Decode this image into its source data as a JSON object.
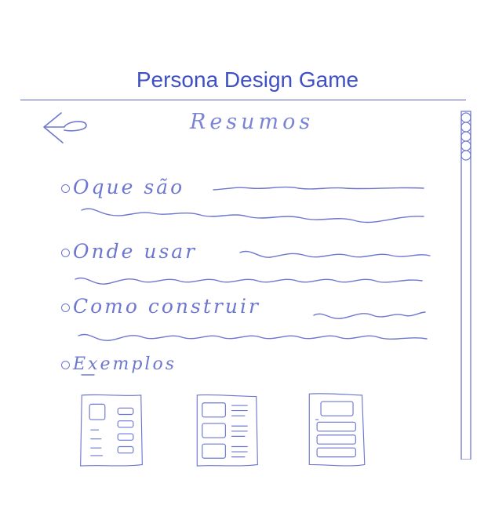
{
  "app": {
    "title": "Persona Design Game"
  },
  "screen": {
    "heading": "Resumos",
    "back_icon": "arrow-left-icon",
    "sections": [
      {
        "label": "Oque são"
      },
      {
        "label": "Onde usar"
      },
      {
        "label": "Como construir"
      },
      {
        "label": "Exemplos"
      }
    ],
    "example_cards": 3
  },
  "colors": {
    "ink": "#5560c8",
    "title": "#3f4fc4"
  }
}
